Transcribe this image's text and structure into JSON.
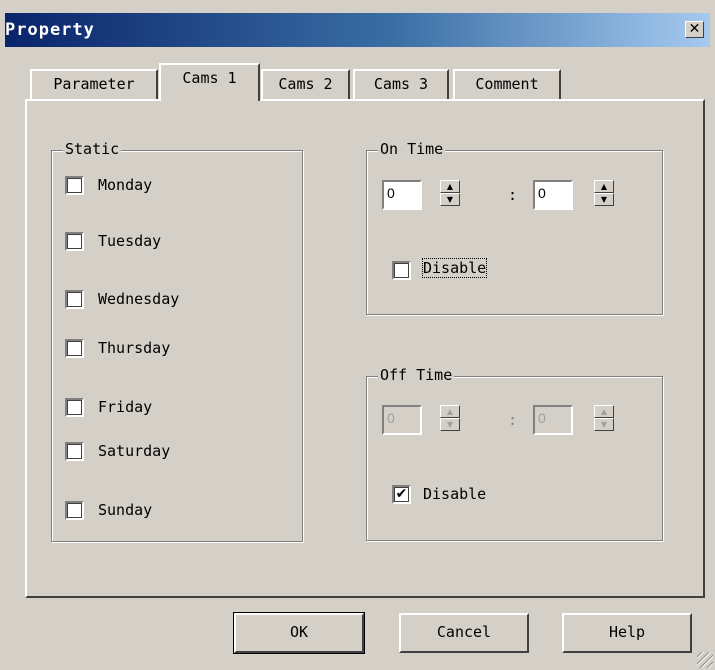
{
  "window": {
    "title": "Property",
    "close_glyph": "✕"
  },
  "tabs": [
    {
      "label": "Parameter",
      "active": false
    },
    {
      "label": "Cams 1",
      "active": true
    },
    {
      "label": "Cams 2",
      "active": false
    },
    {
      "label": "Cams 3",
      "active": false
    },
    {
      "label": "Comment",
      "active": false
    }
  ],
  "static_group": {
    "label": "Static",
    "days": [
      {
        "label": "Monday",
        "checked": false
      },
      {
        "label": "Tuesday",
        "checked": false
      },
      {
        "label": "Wednesday",
        "checked": false
      },
      {
        "label": "Thursday",
        "checked": false
      },
      {
        "label": "Friday",
        "checked": false
      },
      {
        "label": "Saturday",
        "checked": false
      },
      {
        "label": "Sunday",
        "checked": false
      }
    ]
  },
  "on_time": {
    "label": "On Time",
    "hours": "0",
    "minutes": "0",
    "separator": ":",
    "disable_label": "Disable",
    "disabled": false
  },
  "off_time": {
    "label": "Off Time",
    "hours": "0",
    "minutes": "0",
    "separator": ":",
    "disable_label": "Disable",
    "disabled": true,
    "check_glyph": "✔"
  },
  "buttons": {
    "ok": "OK",
    "cancel": "Cancel",
    "help": "Help"
  }
}
